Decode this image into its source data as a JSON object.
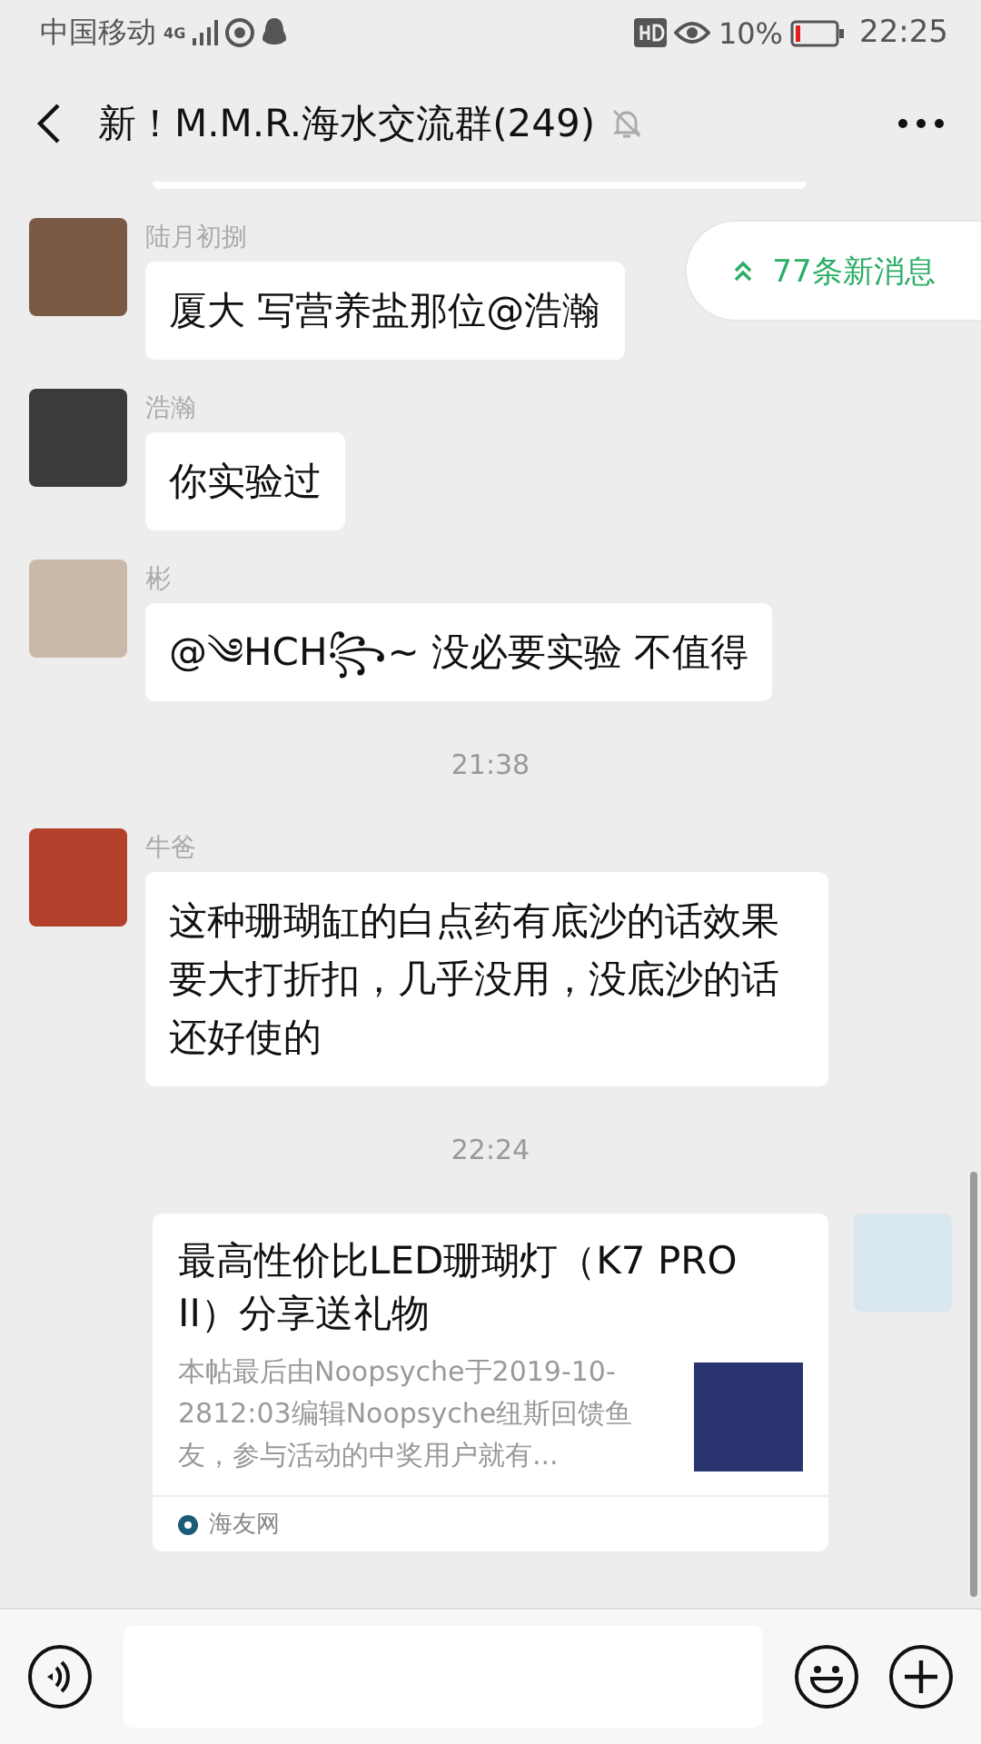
{
  "status_bar": {
    "carrier": "中国移动",
    "network": "4G",
    "battery": "10%",
    "time": "22:25"
  },
  "header": {
    "title": "新！M.M.R.海水交流群(249)"
  },
  "new_messages_badge": {
    "label": "77条新消息"
  },
  "messages": [
    {
      "kind": "text",
      "outgoing": false,
      "sender": "陆月初捌",
      "text": "厦大 写营养盐那位@浩瀚"
    },
    {
      "kind": "text",
      "outgoing": false,
      "sender": "浩瀚",
      "text": "你实验过"
    },
    {
      "kind": "text",
      "outgoing": false,
      "sender": "彬",
      "text": "@༄HCH꧂~ 没必要实验  不值得"
    },
    {
      "kind": "time",
      "text": "21:38"
    },
    {
      "kind": "text",
      "outgoing": false,
      "sender": "牛爸",
      "text": "这种珊瑚缸的白点药有底沙的话效果要大打折扣，几乎没用，没底沙的话还好使的"
    },
    {
      "kind": "time",
      "text": "22:24"
    },
    {
      "kind": "link",
      "outgoing": true,
      "title": "最高性价比LED珊瑚灯（K7 PRO II）分享送礼物",
      "description": "本帖最后由Noopsyche于2019-10-2812:03编辑Noopsyche纽斯回馈鱼友，参与活动的中奖用户就有...",
      "source": "海友网"
    }
  ]
}
